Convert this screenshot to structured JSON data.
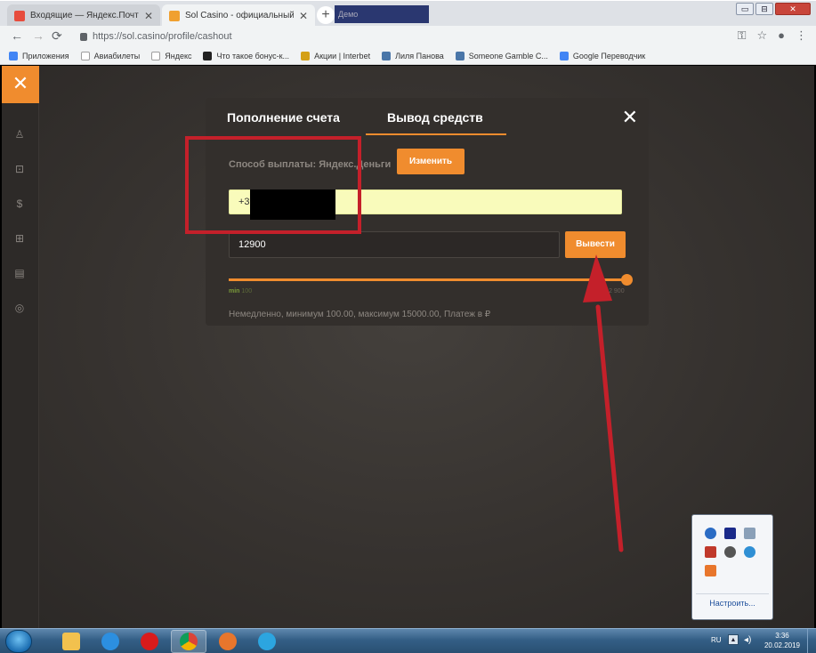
{
  "browser": {
    "tabs": [
      {
        "title": "Входящие — Яндекс.Почта",
        "favicon_color": "#e74c3c"
      },
      {
        "title": "Sol Casino - официальный сайт",
        "favicon_color": "#f0a030"
      }
    ],
    "blurred_tab_text": "Демо",
    "window_controls": {
      "minimize": "▭",
      "maximize": "⊟",
      "close": "✕"
    },
    "url": "https://sol.casino/profile/cashout",
    "nav": {
      "back": "←",
      "forward": "→",
      "reload": "⟳"
    },
    "addr_icons": {
      "key": "⚿",
      "star": "☆",
      "account": "●",
      "menu": "⋮"
    },
    "bookmarks": [
      {
        "label": "Приложения",
        "icon_color": "#4285f4"
      },
      {
        "label": "Авиабилеты",
        "icon_color": "#9e9e9e"
      },
      {
        "label": "Яндекс",
        "icon_color": "#9e9e9e"
      },
      {
        "label": "Что такое бонус-к...",
        "icon_color": "#222222"
      },
      {
        "label": "Акции | Interbet",
        "icon_color": "#d4a017"
      },
      {
        "label": "Лиля Панова",
        "icon_color": "#4a76a8"
      },
      {
        "label": "Someone Gamble C...",
        "icon_color": "#4a76a8"
      },
      {
        "label": "Google Переводчик",
        "icon_color": "#4285f4"
      }
    ]
  },
  "sidebar": {
    "close_glyph": "✕",
    "icons": [
      "user-icon",
      "gamepad-icon",
      "dollar-icon",
      "gift-icon",
      "wallet-icon",
      "support-icon"
    ],
    "glyphs": [
      "♙",
      "⊡",
      "$",
      "⊞",
      "▤",
      "◎"
    ]
  },
  "modal": {
    "tab_deposit": "Пополнение счета",
    "tab_withdraw": "Вывод средств",
    "close_glyph": "✕",
    "method_label": "Способ выплаты: Яндекс.Деньги",
    "change_button": "Изменить",
    "phone_value": "+3751",
    "amount_value": "12900",
    "withdraw_button": "Вывести",
    "slider_position": 1.0,
    "min_label": "min",
    "min_value": "100",
    "max_label": "max",
    "max_value": "12 900",
    "info_text": "Немедленно, минимум 100.00, максимум 15000.00, Платеж в ₽"
  },
  "tray_popup": {
    "icons": [
      "#2b6cc4",
      "#1a2a8a",
      "#8aa0b8",
      "#c0392b",
      "#555555",
      "#2f8fd4",
      "#e8762c"
    ],
    "link": "Настроить..."
  },
  "taskbar": {
    "apps": [
      {
        "name": "explorer",
        "color": "#f2c14e",
        "active": false
      },
      {
        "name": "ie",
        "color": "#2c8fe0",
        "active": false
      },
      {
        "name": "opera",
        "color": "#d91b1b",
        "active": false
      },
      {
        "name": "chrome",
        "color": "#3aa757",
        "active": true
      },
      {
        "name": "firefox",
        "color": "#e8762c",
        "active": false
      },
      {
        "name": "telegram",
        "color": "#2ca5e0",
        "active": false
      }
    ],
    "lang": "RU",
    "tray_up": "▲",
    "speaker": "◂)",
    "time": "3:36",
    "date": "20.02.2019"
  }
}
